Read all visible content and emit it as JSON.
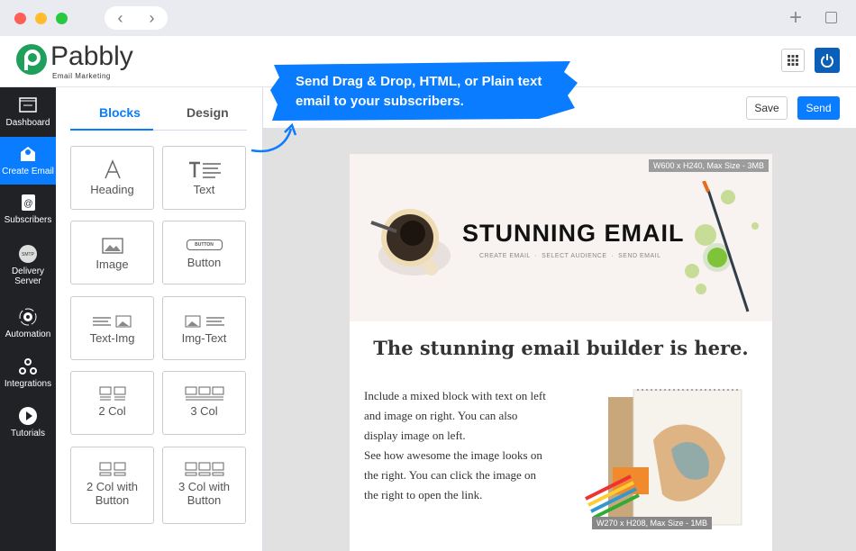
{
  "browser": {
    "back": "‹",
    "forward": "›",
    "new_tab": "+"
  },
  "header": {
    "logo_text": "Pabbly",
    "logo_sub": "Email Marketing"
  },
  "callout": {
    "line1": "Send Drag & Drop, HTML, or Plain text",
    "line2": "email to your subscribers."
  },
  "sidebar": {
    "items": [
      {
        "label": "Dashboard",
        "icon": "dashboard-icon"
      },
      {
        "label": "Create Email",
        "icon": "envelope-icon",
        "active": true
      },
      {
        "label": "Subscribers",
        "icon": "address-book-icon"
      },
      {
        "label": "Delivery Server",
        "icon": "smtp-icon",
        "badge": "SMTP"
      },
      {
        "label": "Automation",
        "icon": "gear-icon"
      },
      {
        "label": "Integrations",
        "icon": "webhook-icon"
      },
      {
        "label": "Tutorials",
        "icon": "play-icon"
      }
    ]
  },
  "panel": {
    "tabs": [
      {
        "label": "Blocks",
        "active": true
      },
      {
        "label": "Design"
      }
    ],
    "blocks": [
      "Heading",
      "Text",
      "Image",
      "Button",
      "Text-Img",
      "Img-Text",
      "2 Col",
      "3 Col",
      "2 Col with Button",
      "3 Col with Button"
    ],
    "button_preview": "BUTTON"
  },
  "toolbar": {
    "save": "Save",
    "send": "Send"
  },
  "email": {
    "hero_badge": "W600 x H240, Max Size - 3MB",
    "hero_title": "STUNNING EMAIL",
    "hero_sub": "CREATE EMAIL  ·  SELECT AUDIENCE  ·  SEND EMAIL",
    "heading": "The stunning email builder is here.",
    "body_lines": [
      "Include a mixed block with text on left",
      "and image on right. You can also",
      "display image on left.",
      "See how awesome the image looks on",
      "the right. You can click the image on",
      "the right to open the link."
    ],
    "image_badge": "W270 x H208, Max Size - 1MB"
  },
  "colors": {
    "accent": "#0a7cff",
    "sidebar": "#202226",
    "logo_green": "#1fa05a"
  }
}
